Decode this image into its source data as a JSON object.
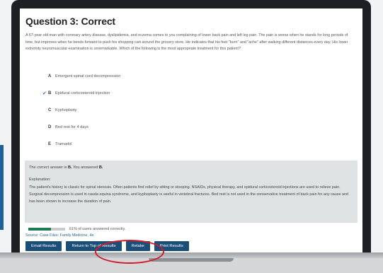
{
  "question": {
    "title": "Question 3: Correct",
    "stem": "A 67-year-old man with coronary artery disease, dyslipidemia, and eczema comes to you complaining of lower back pain and left leg pain. The pain is worse when he stands for long periods of time, but improves when he bends forward to push his shopping cart around the grocery store. He indicates that his feet \"burn\" and \"ache\" after walking different distances every day. His lower extremity neuromuscular examination is unremarkable. Which of the following is the most appropriate treatment for this patient?"
  },
  "answers": [
    {
      "letter": "A",
      "text": "Emergent spinal cord decompression",
      "mark": ""
    },
    {
      "letter": "B",
      "text": "Epidural corticosteroid injection",
      "mark": "✓"
    },
    {
      "letter": "C",
      "text": "Kyphoplasty",
      "mark": ""
    },
    {
      "letter": "D",
      "text": "Bed rest for 4 days",
      "mark": ""
    },
    {
      "letter": "E",
      "text": "Tramadol",
      "mark": ""
    }
  ],
  "result": {
    "correct_prefix": "The correct answer is ",
    "correct_letter": "B.",
    "answered_prefix": " You answered ",
    "answered_letter": "B.",
    "explanation_heading": "Explanation:",
    "explanation": "The patient's history is classic for spinal stenosis. Often patients find relief by sitting or stooping. NSAIDs, physical therapy, and epidural corticosteroid injections are used to relieve pain. Surgical decompression is used in cauda equina syndrome, and kyphoplasty is useful in vertebral fractures. Bed rest is not used in the conservative treatment of back pain for any cause and has been shown to increase the duration of pain.",
    "percent_correct": 61,
    "stats_text": "61% of users answered correctly."
  },
  "source": "Source: Case Files: Family Medicine, 4e",
  "buttons": {
    "email": "Email Results",
    "return_top": "Return to Top of Results",
    "retake": "Retake",
    "print": "Print Results"
  },
  "colors": {
    "accent": "#1f5f9b",
    "button": "#1b4f7a",
    "progress": "#1f7a55",
    "highlight": "#d21a27",
    "explanation_bg": "#dfe2e3"
  }
}
